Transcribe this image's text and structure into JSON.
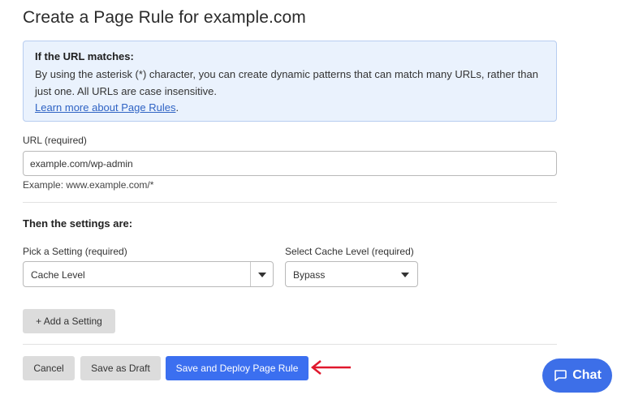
{
  "page": {
    "title": "Create a Page Rule for example.com"
  },
  "info_box": {
    "heading": "If the URL matches:",
    "text": "By using the asterisk (*) character, you can create dynamic patterns that can match many URLs, rather than just one. All URLs are case insensitive.",
    "link_label": "Learn more about Page Rules",
    "link_suffix": "."
  },
  "url_field": {
    "label": "URL (required)",
    "value": "example.com/wp-admin",
    "hint": "Example: www.example.com/*"
  },
  "settings": {
    "heading": "Then the settings are:",
    "setting_label": "Pick a Setting (required)",
    "setting_value": "Cache Level",
    "cache_label": "Select Cache Level (required)",
    "cache_value": "Bypass",
    "add_button": "+ Add a Setting"
  },
  "actions": {
    "cancel": "Cancel",
    "save_draft": "Save as Draft",
    "deploy": "Save and Deploy Page Rule"
  },
  "chat": {
    "label": "Chat"
  },
  "colors": {
    "primary": "#3b6ff0",
    "info_bg": "#eaf2fd",
    "annotation_arrow": "#e0182d"
  }
}
